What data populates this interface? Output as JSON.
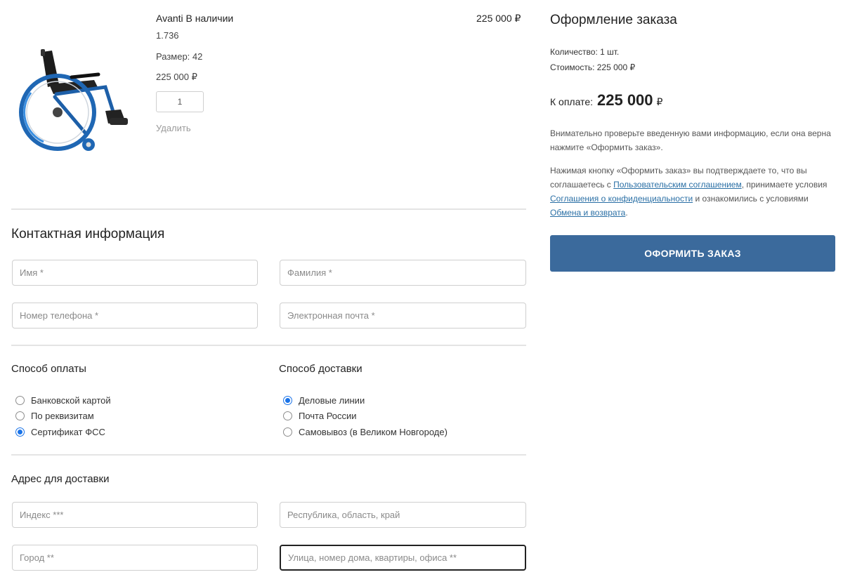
{
  "product": {
    "name": "Avanti В наличии",
    "code": "1.736",
    "size": "Размер: 42",
    "price": "225 000 ₽",
    "quantity": "1",
    "remove_label": "Удалить",
    "line_total": "225 000 ₽"
  },
  "contact": {
    "title": "Контактная информация",
    "first_name_placeholder": "Имя *",
    "last_name_placeholder": "Фамилия *",
    "phone_placeholder": "Номер телефона *",
    "email_placeholder": "Электронная почта *"
  },
  "payment": {
    "title": "Способ оплаты",
    "options": [
      {
        "label": "Банковской картой",
        "checked": false
      },
      {
        "label": "По реквизитам",
        "checked": false
      },
      {
        "label": "Сертификат ФСС",
        "checked": true
      }
    ]
  },
  "delivery": {
    "title": "Способ доставки",
    "options": [
      {
        "label": "Деловые линии",
        "checked": true
      },
      {
        "label": "Почта России",
        "checked": false
      },
      {
        "label": "Самовывоз (в Великом Новгороде)",
        "checked": false
      }
    ]
  },
  "address": {
    "title": "Адрес для доставки",
    "index_placeholder": "Индекс ***",
    "region_placeholder": "Республика, область, край",
    "city_placeholder": "Город **",
    "street_placeholder": "Улица, номер дома, квартиры, офиса **"
  },
  "summary": {
    "title": "Оформление заказа",
    "quantity_line": "Количество: 1 шт.",
    "cost_line": "Стоимость: 225 000 ₽",
    "pay_label": "К оплате:",
    "pay_amount": "225 000",
    "pay_currency": "₽",
    "note1": "Внимательно проверьте введенную вами информацию, если она верна нажмите «Оформить заказ».",
    "note2_part1": "Нажимая кнопку «Оформить заказ» вы подтверждаете то, что вы соглашаетесь с ",
    "link_user_agreement": "Пользовательским соглашением",
    "note2_part2": ", принимаете условия ",
    "link_privacy": "Соглашения о конфиденциальности",
    "note2_part3": " и ознакомились с условиями ",
    "link_returns": "Обмена и возврата",
    "note2_part4": ".",
    "order_button": "ОФОРМИТЬ ЗАКАЗ"
  },
  "colors": {
    "accent": "#3b6a9c",
    "link": "#2a6fa5",
    "radio_checked": "#1a73e8"
  }
}
